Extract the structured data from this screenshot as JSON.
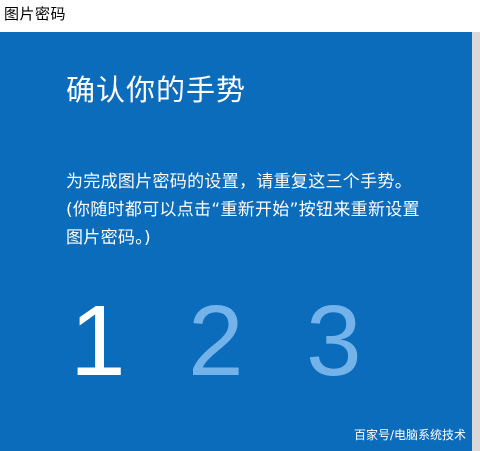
{
  "window": {
    "title": "图片密码"
  },
  "main": {
    "heading": "确认你的手势",
    "instruction": "为完成图片密码的设置，请重复这三个手势。(你随时都可以点击“重新开始”按钮来重新设置图片密码。)",
    "steps": [
      {
        "label": "1",
        "state": "current"
      },
      {
        "label": "2",
        "state": "pending"
      },
      {
        "label": "3",
        "state": "pending"
      }
    ]
  },
  "watermark": "百家号/电脑系统技术",
  "colors": {
    "panel": "#0b6cbc",
    "step_current": "#ffffff",
    "step_pending": "#74b3ea"
  }
}
